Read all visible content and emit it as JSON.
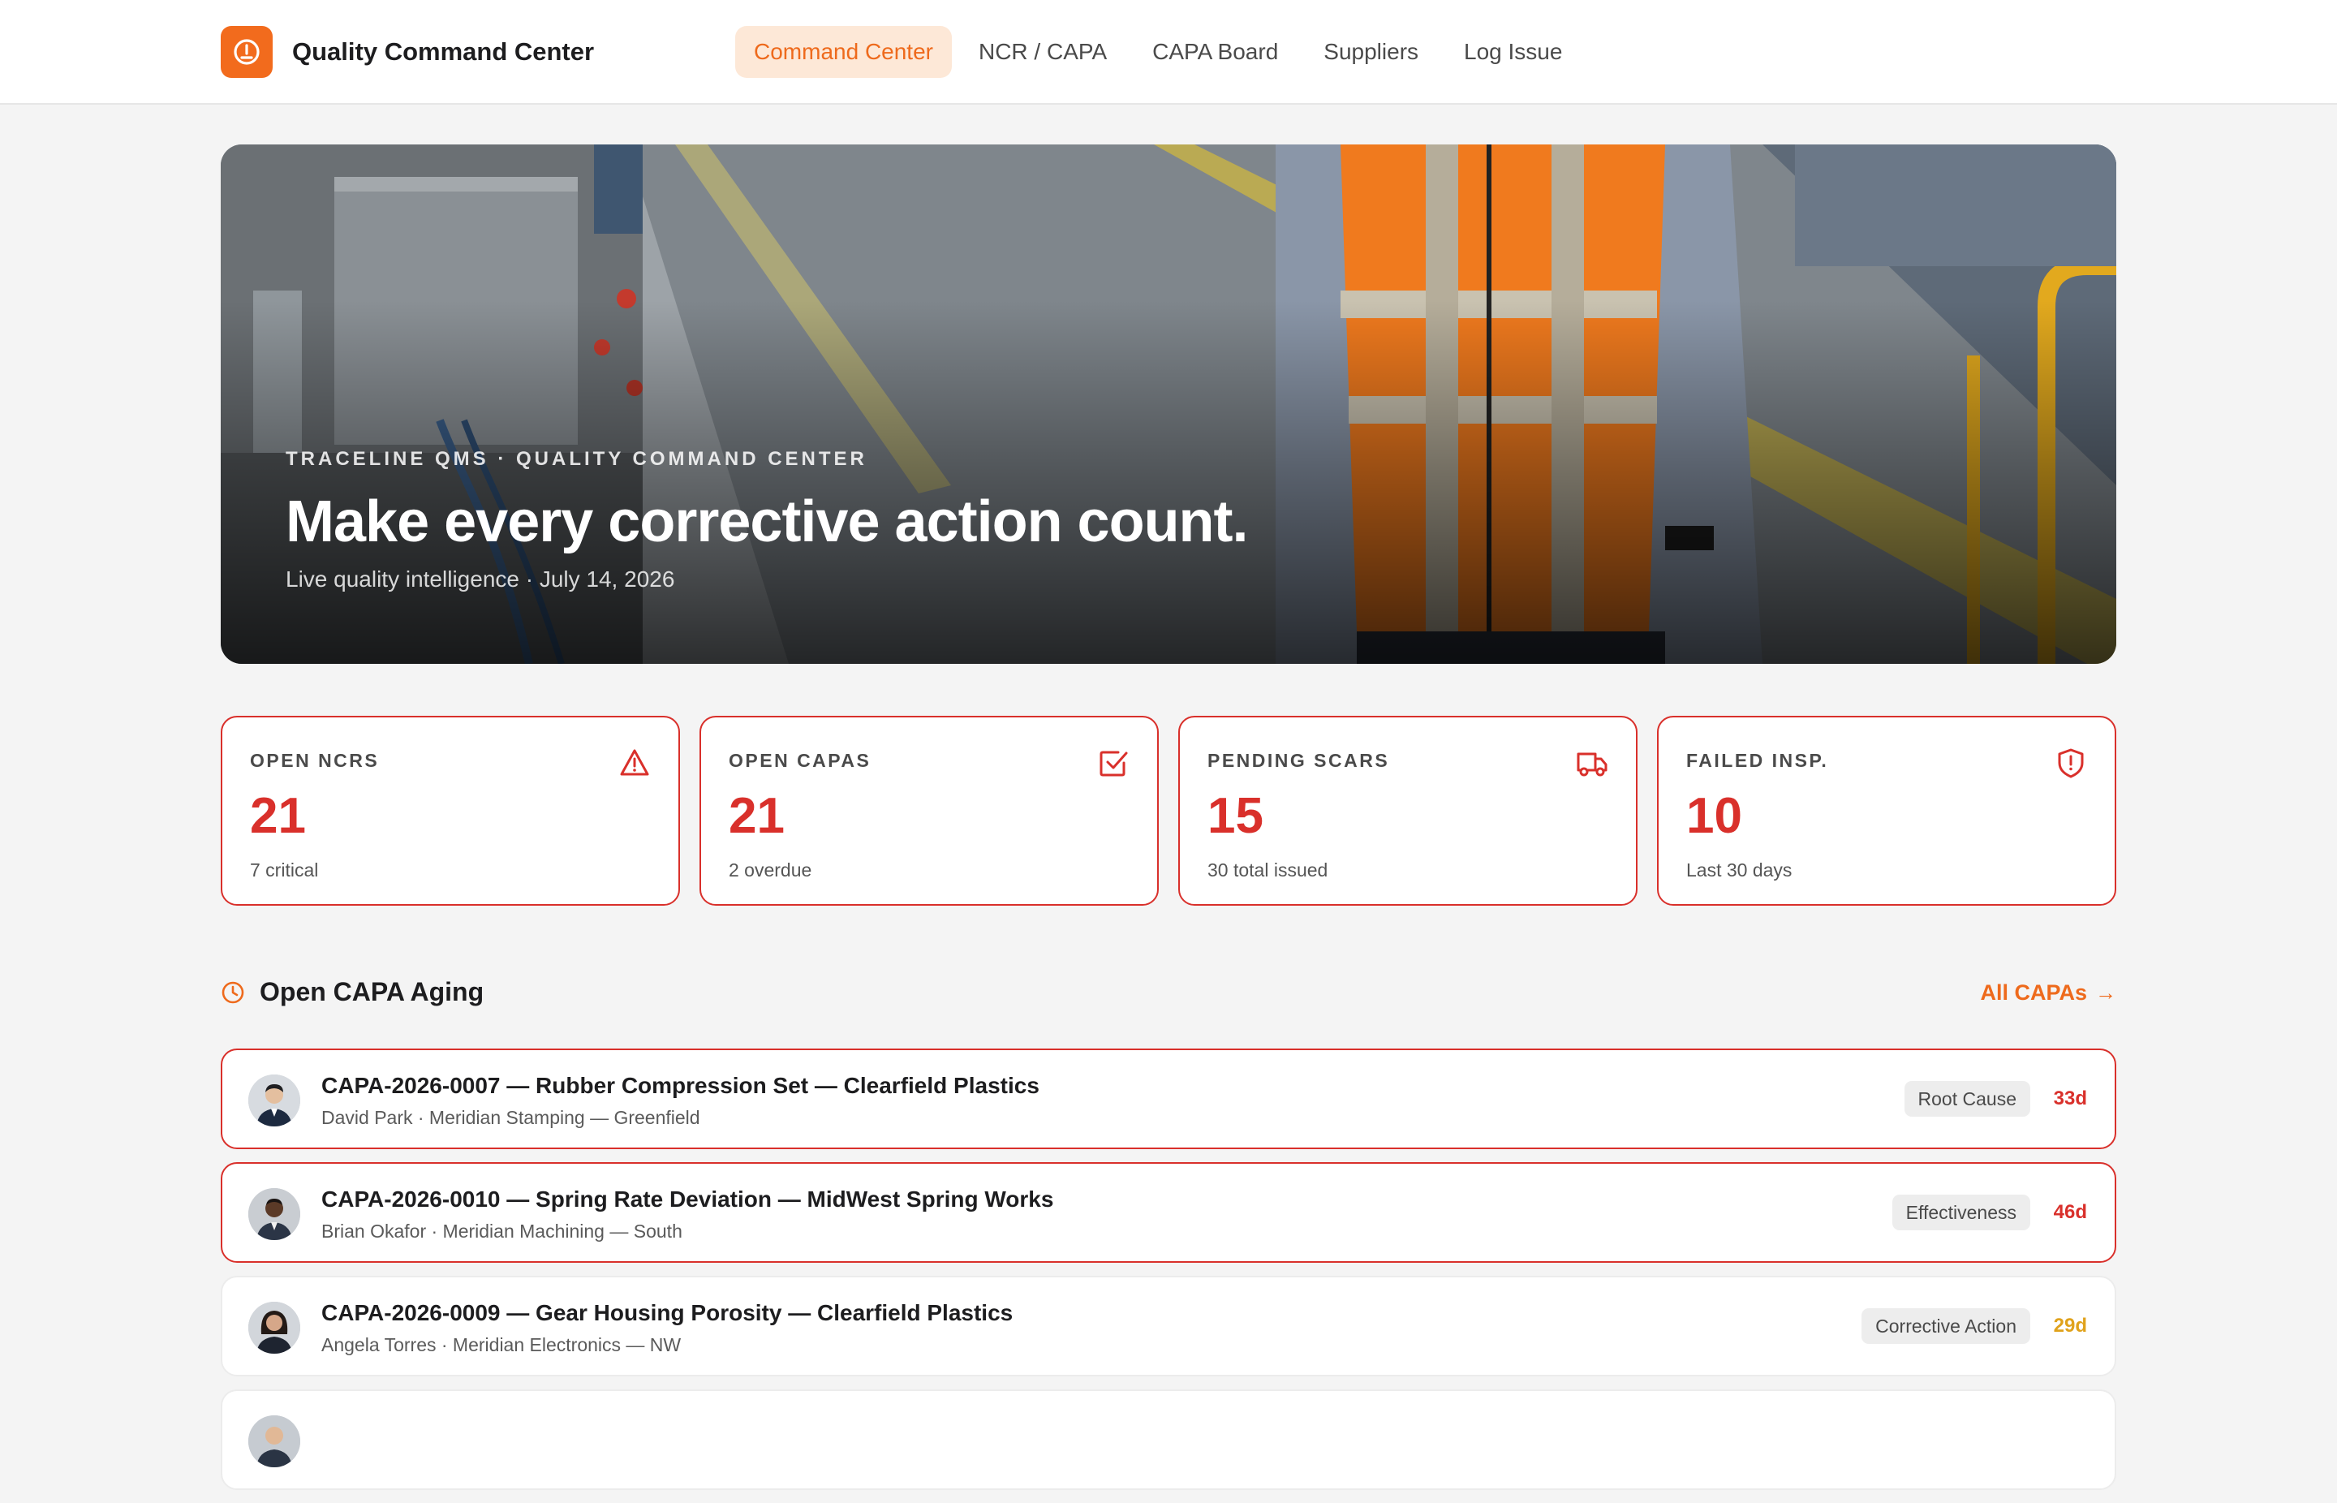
{
  "app": {
    "name": "Quality Command Center"
  },
  "nav": {
    "items": [
      {
        "label": "Command Center",
        "active": true
      },
      {
        "label": "NCR / CAPA",
        "active": false
      },
      {
        "label": "CAPA Board",
        "active": false
      },
      {
        "label": "Suppliers",
        "active": false
      },
      {
        "label": "Log Issue",
        "active": false
      }
    ]
  },
  "hero": {
    "eyebrow": "TRACELINE QMS · QUALITY COMMAND CENTER",
    "title": "Make every corrective action count.",
    "subtitle": "Live quality intelligence · July 14, 2026"
  },
  "kpis": [
    {
      "label": "OPEN NCRS",
      "value": "21",
      "note": "7 critical",
      "icon": "warning-triangle-icon"
    },
    {
      "label": "OPEN CAPAS",
      "value": "21",
      "note": "2 overdue",
      "icon": "checkbox-icon"
    },
    {
      "label": "PENDING SCARS",
      "value": "15",
      "note": "30 total issued",
      "icon": "truck-icon"
    },
    {
      "label": "FAILED INSP.",
      "value": "10",
      "note": "Last 30 days",
      "icon": "shield-alert-icon"
    }
  ],
  "aging": {
    "title": "Open CAPA Aging",
    "link_label": "All CAPAs",
    "rows": [
      {
        "title": "CAPA-2026-0007 — Rubber Compression Set — Clearfield Plastics",
        "meta": "David Park · Meridian Stamping — Greenfield",
        "stage": "Root Cause",
        "age": "33d",
        "flagged": true
      },
      {
        "title": "CAPA-2026-0010 — Spring Rate Deviation — MidWest Spring Works",
        "meta": "Brian Okafor · Meridian Machining — South",
        "stage": "Effectiveness",
        "age": "46d",
        "flagged": true
      },
      {
        "title": "CAPA-2026-0009 — Gear Housing Porosity — Clearfield Plastics",
        "meta": "Angela Torres · Meridian Electronics — NW",
        "stage": "Corrective Action",
        "age": "29d",
        "flagged": false
      }
    ]
  },
  "colors": {
    "accent": "#ee6a1c",
    "critical": "#d9302b",
    "warning": "#e0a21b"
  }
}
